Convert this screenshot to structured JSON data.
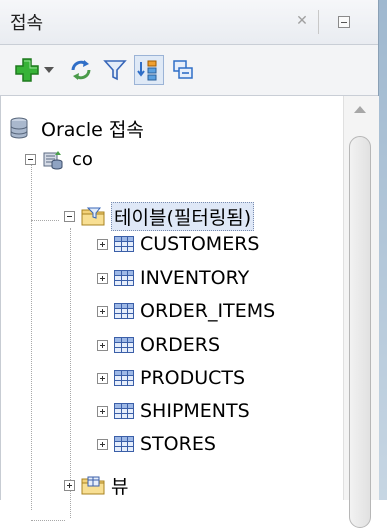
{
  "panel": {
    "title": "접속"
  },
  "tree": {
    "root_label": "Oracle 접속",
    "connection_label": "co",
    "tables_folder_label": "테이블(필터링됨)",
    "tables": [
      "CUSTOMERS",
      "INVENTORY",
      "ORDER_ITEMS",
      "ORDERS",
      "PRODUCTS",
      "SHIPMENTS",
      "STORES"
    ],
    "views_folder_label": "뷰"
  },
  "toolbar": {
    "icons": [
      "add-connection-icon",
      "dropdown-arrow-icon",
      "refresh-icon",
      "filter-icon",
      "schema-browser-icon",
      "collapse-icon"
    ]
  },
  "colors": {
    "accent_blue": "#3b5fa8",
    "add_green": "#2fa82f",
    "selection_bg": "#dfe8f7"
  }
}
